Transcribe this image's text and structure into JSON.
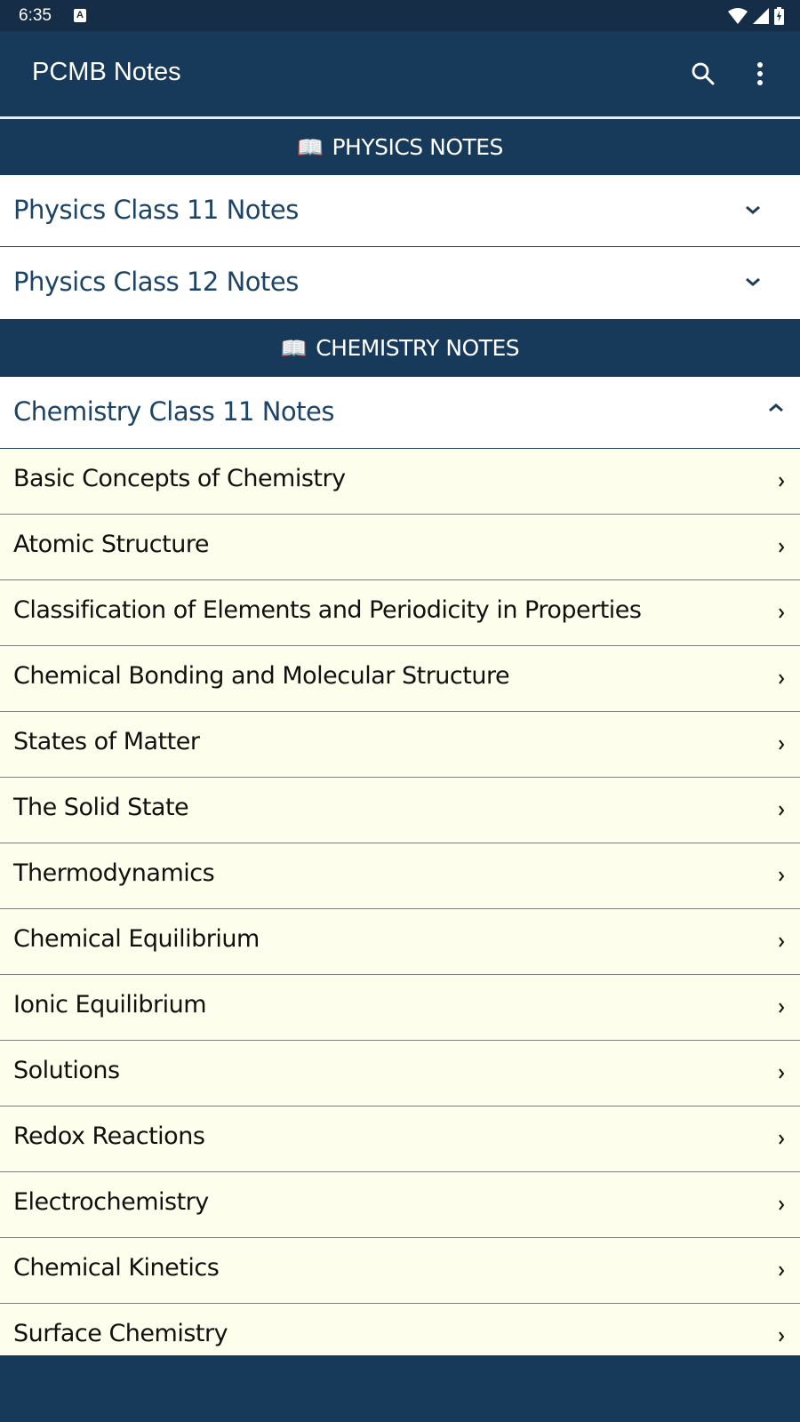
{
  "status_bar": {
    "time": "6:35",
    "notification_icon": "a-letter-icon",
    "indicators": [
      "wifi-icon",
      "signal-icon",
      "battery-charging-icon"
    ]
  },
  "app_bar": {
    "title": "PCMB Notes",
    "actions": [
      "search-icon",
      "more-vert-icon"
    ]
  },
  "colors": {
    "primary": "#183a5a",
    "status_bar": "#152d46",
    "accordion_text": "#1c4466",
    "sub_item_bg": "#fefeec"
  },
  "sections": [
    {
      "title": "PHYSICS NOTES",
      "icon": "📖",
      "groups": [
        {
          "label": "Physics Class 11 Notes",
          "expanded": false
        },
        {
          "label": "Physics Class 12 Notes",
          "expanded": false
        }
      ]
    },
    {
      "title": "CHEMISTRY NOTES",
      "icon": "📖",
      "groups": [
        {
          "label": "Chemistry Class 11 Notes",
          "expanded": true,
          "items": [
            "Basic Concepts of Chemistry",
            "Atomic Structure",
            "Classification of Elements and Periodicity in Properties",
            "Chemical Bonding and Molecular Structure",
            "States of Matter",
            "The Solid State",
            "Thermodynamics",
            "Chemical Equilibrium",
            "Ionic Equilibrium",
            "Solutions",
            "Redox Reactions",
            "Electrochemistry",
            "Chemical Kinetics",
            "Surface Chemistry"
          ]
        }
      ]
    }
  ]
}
